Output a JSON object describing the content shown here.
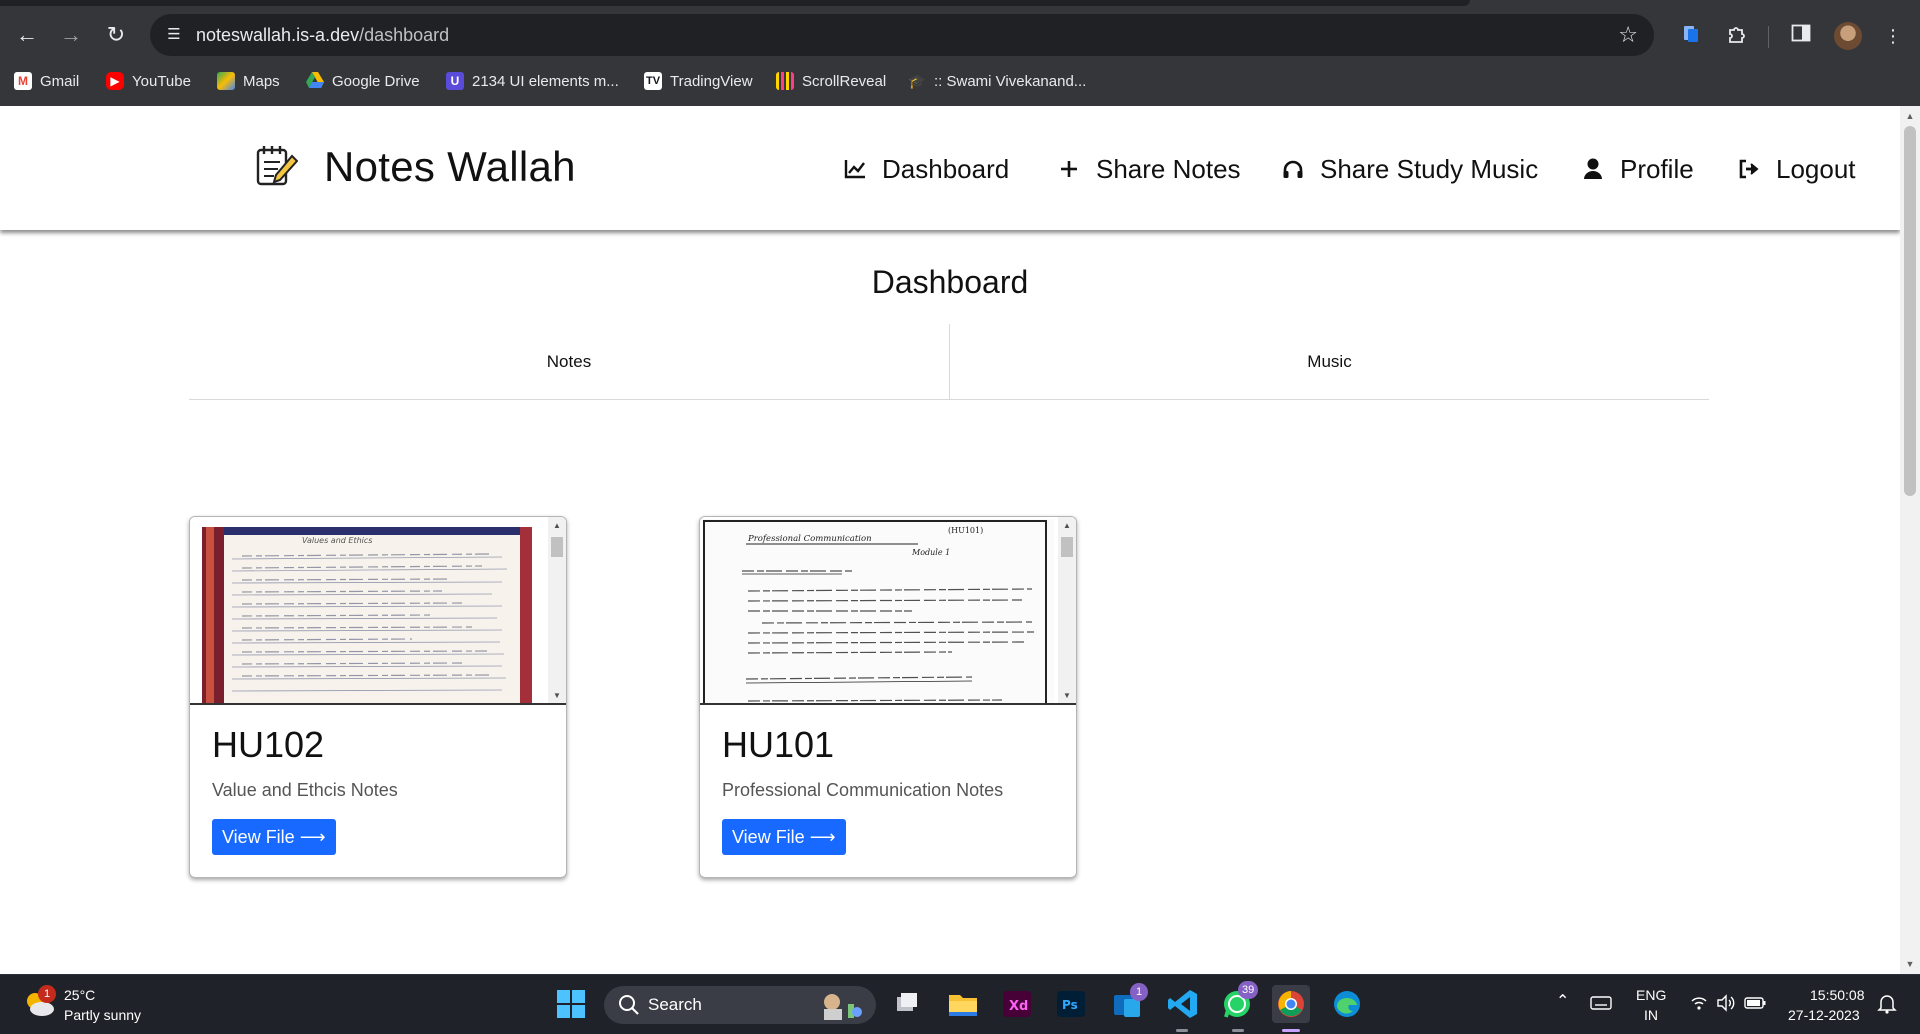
{
  "browser": {
    "url_host": "noteswallah.is-a.dev",
    "url_path": "/dashboard",
    "bookmarks": [
      {
        "label": "Gmail",
        "icon": "gmail-icon"
      },
      {
        "label": "YouTube",
        "icon": "youtube-icon"
      },
      {
        "label": "Maps",
        "icon": "maps-icon"
      },
      {
        "label": "Google Drive",
        "icon": "drive-icon"
      },
      {
        "label": "2134 UI elements m...",
        "icon": "ui-elements-icon"
      },
      {
        "label": "TradingView",
        "icon": "tradingview-icon"
      },
      {
        "label": "ScrollReveal",
        "icon": "scrollreveal-icon"
      },
      {
        "label": ":: Swami Vivekanand...",
        "icon": "graduation-cap-icon"
      }
    ]
  },
  "site": {
    "brand": "Notes Wallah",
    "nav": [
      {
        "label": "Dashboard",
        "icon": "chart-line-icon"
      },
      {
        "label": "Share Notes",
        "icon": "plus-icon"
      },
      {
        "label": "Share Study Music",
        "icon": "headphones-icon"
      },
      {
        "label": "Profile",
        "icon": "user-icon"
      },
      {
        "label": "Logout",
        "icon": "logout-icon"
      }
    ]
  },
  "main": {
    "heading": "Dashboard",
    "tabs": [
      "Notes",
      "Music"
    ],
    "cards": [
      {
        "title": "HU102",
        "description": "Value and Ethcis Notes",
        "button": "View File ⟶",
        "preview_heading": "Values and Ethics"
      },
      {
        "title": "HU101",
        "description": "Professional Communication Notes",
        "button": "View File ⟶",
        "preview_heading": "Professional Communication",
        "preview_code": "(HU101)",
        "preview_module": "Module 1"
      }
    ]
  },
  "taskbar": {
    "weather_temp": "25°C",
    "weather_desc": "Partly sunny",
    "weather_badge": "1",
    "search_label": "Search",
    "mail_badge": "1",
    "whatsapp_badge": "39",
    "lang_line1": "ENG",
    "lang_line2": "IN",
    "time": "15:50:08",
    "date": "27-12-2023"
  },
  "colors": {
    "chrome_dark": "#35363a",
    "omnibox": "#202124",
    "accent_button": "#1769ff",
    "taskbar": "#1f2228"
  }
}
